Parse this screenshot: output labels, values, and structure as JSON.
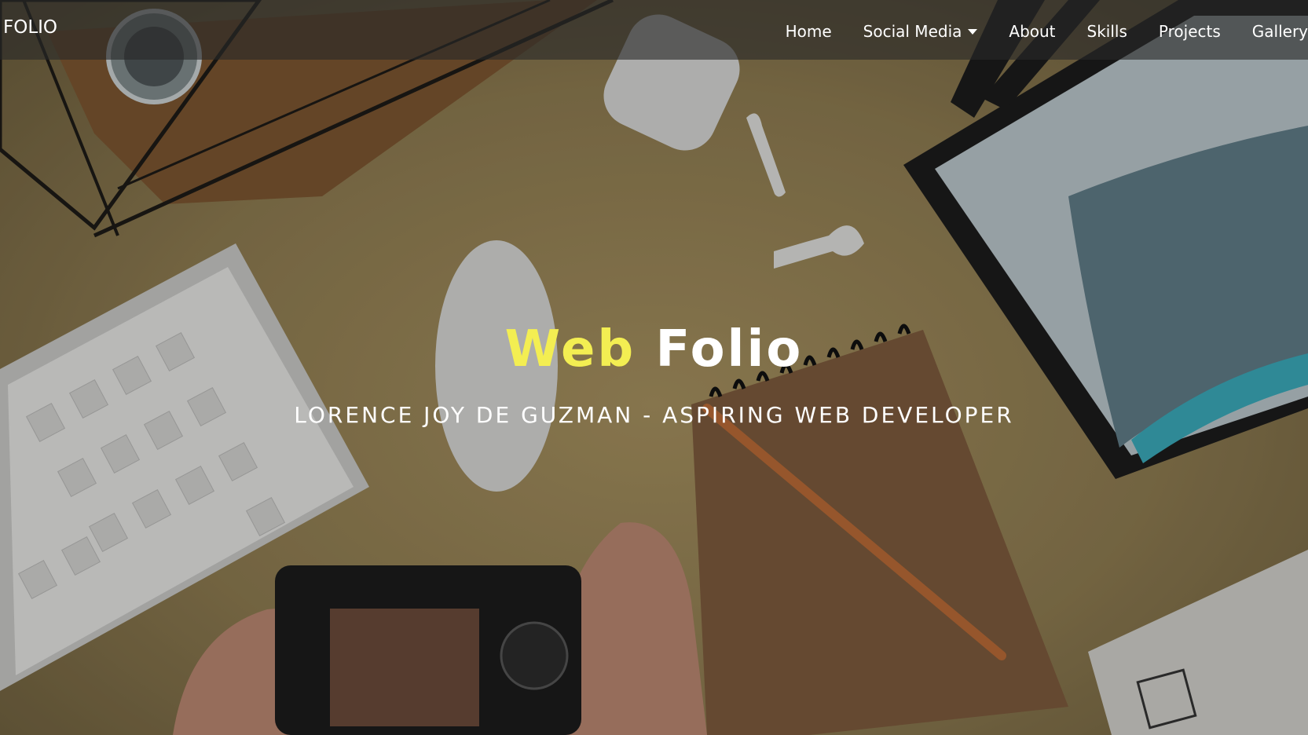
{
  "navbar": {
    "brand": "FOLIO",
    "items": [
      {
        "label": "Home"
      },
      {
        "label": "Social Media",
        "dropdown": true
      },
      {
        "label": "About"
      },
      {
        "label": "Skills"
      },
      {
        "label": "Projects"
      },
      {
        "label": "Gallery"
      }
    ]
  },
  "hero": {
    "title_accent": "Web",
    "title_rest": "Folio",
    "subtitle": "LORENCE JOY DE GUZMAN - ASPIRING WEB DEVELOPER",
    "background_image": "desk-flatlay"
  },
  "colors": {
    "accent": "#f3ee52",
    "nav_text": "#ffffff",
    "desk": "#a48f5e"
  }
}
